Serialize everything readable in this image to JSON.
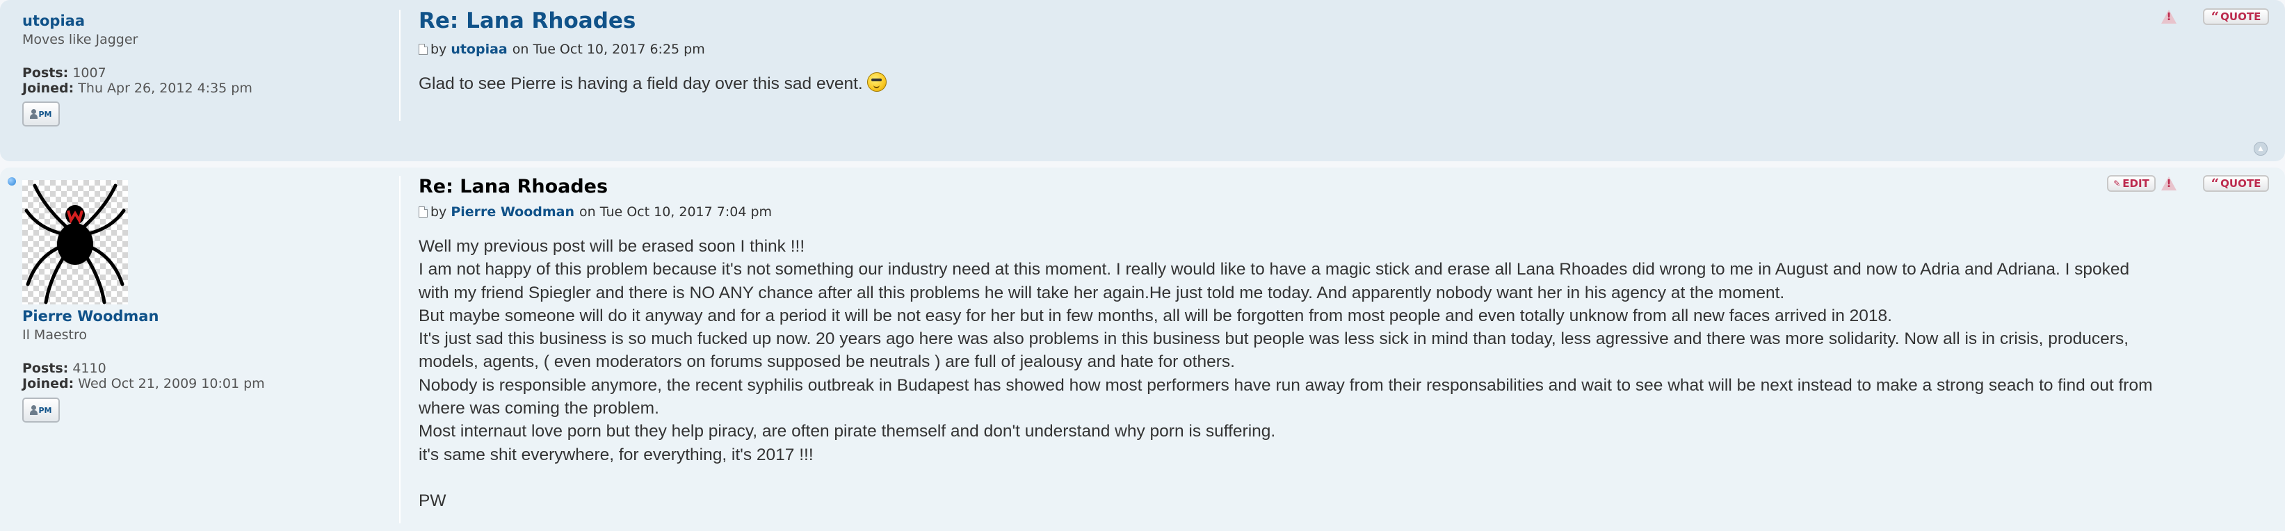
{
  "posts": [
    {
      "author": {
        "name": "utopiaa",
        "rank": "Moves like Jagger",
        "posts_label": "Posts:",
        "posts_value": "1007",
        "joined_label": "Joined:",
        "joined_value": "Thu Apr 26, 2012 4:35 pm",
        "pm_label": "PM"
      },
      "title": "Re: Lana Rhoades",
      "byline": {
        "by": "by",
        "username": "utopiaa",
        "date": "on Tue Oct 10, 2017 6:25 pm"
      },
      "content": "Glad to see Pierre is having a field day over this sad event.",
      "smiley": "cool-smiley",
      "buttons": {
        "report_label": "!",
        "quote_label": "QUOTE"
      }
    },
    {
      "author": {
        "name": "Pierre Woodman",
        "rank": "Il Maestro",
        "posts_label": "Posts:",
        "posts_value": "4110",
        "joined_label": "Joined:",
        "joined_value": "Wed Oct 21, 2009 10:01 pm",
        "pm_label": "PM",
        "avatar": "black-widow-spider-avatar"
      },
      "title": "Re: Lana Rhoades",
      "byline": {
        "by": "by",
        "username": "Pierre Woodman",
        "date": "on Tue Oct 10, 2017 7:04 pm"
      },
      "content_lines": [
        "Well my previous post will be erased soon I think !!!",
        "I am not happy of this problem because it's not something our industry need at this moment. I really would like to have a magic stick and erase all Lana Rhoades did wrong to me in August and now to Adria and Adriana. I spoked",
        "with my friend Spiegler and there is NO ANY chance after all this problems he will take her again.He just told me today. And apparently nobody want her in his agency at the moment.",
        "But maybe someone will do it anyway and for a period it will be not easy for her but in few months, all will be forgotten from most people and even totally unknow from all new faces arrived in 2018.",
        "It's just sad this business is so much fucked up now. 20 years ago here was also problems in this business but people was less sick in mind than today, less agressive and there was more solidarity. Now all is in crisis, producers,",
        "models, agents, ( even moderators on forums supposed be neutrals ) are full of jealousy and hate for others.",
        "Nobody is responsible anymore, the recent syphilis outbreak in Budapest has showed how most performers have run away from their responsabilities and wait to see what will be next instead to make a strong seach to find out from",
        "where was coming the problem.",
        "Most internaut love porn but they help piracy, are often pirate themself and don't understand why porn is suffering.",
        "it's same shit everywhere, for everything, it's 2017 !!!",
        "",
        "PW"
      ],
      "buttons": {
        "edit_label": "EDIT",
        "report_label": "!",
        "quote_label": "QUOTE"
      }
    }
  ],
  "colors": {
    "link_blue": "#105289",
    "post_bg_2": "#e1ebf2",
    "post_bg_1": "#ecf3f7",
    "button_red": "#bc2a4d"
  }
}
